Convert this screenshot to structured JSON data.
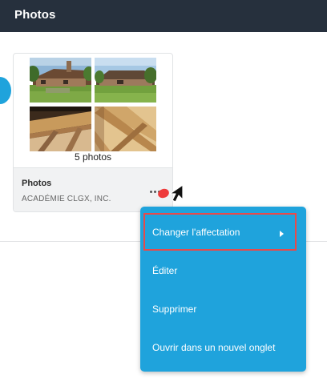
{
  "header": {
    "title": "Photos"
  },
  "card": {
    "photo_count": "5 photos",
    "title": "Photos",
    "subtitle": "ACADÉMIE CLGX, INC.",
    "thumbnails": [
      "house-exterior-icon",
      "house-exterior-icon",
      "attic-wood-icon",
      "attic-wood-icon"
    ]
  },
  "context_menu": {
    "items": [
      {
        "label": "Changer l'affectation",
        "has_submenu": true,
        "highlighted": true
      },
      {
        "label": "Éditer"
      },
      {
        "label": "Supprimer"
      },
      {
        "label": "Ouvrir dans un nouvel onglet"
      }
    ]
  },
  "colors": {
    "topbar": "#26303d",
    "menu": "#1fa3dc",
    "highlight": "#e84a4a"
  }
}
